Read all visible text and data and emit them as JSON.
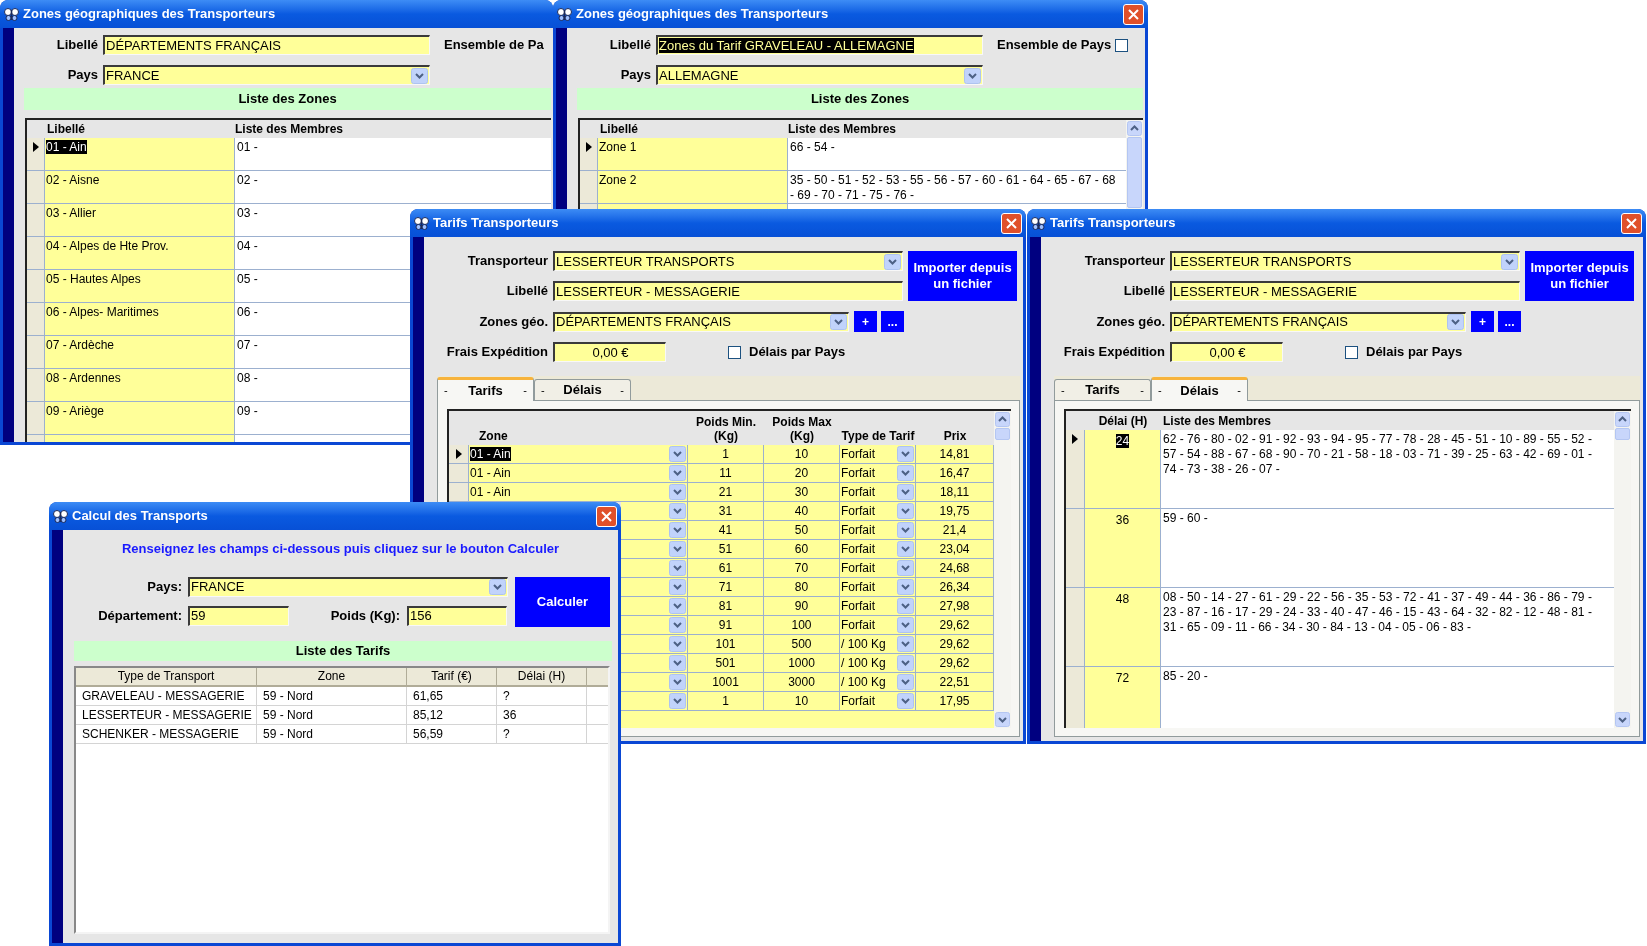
{
  "windows": [
    {
      "kind": "zones",
      "title": "Zones géographiques des Transporteurs",
      "libelle": {
        "label": "Libellé",
        "value": "DÉPARTEMENTS FRANÇAIS",
        "highlighted": false
      },
      "ensemble": {
        "label": "Ensemble de Pa"
      },
      "pays": {
        "label": "Pays",
        "value": "FRANCE"
      },
      "section": "Liste des Zones",
      "columns": [
        "Libellé",
        "Liste des Membres"
      ],
      "rows": [
        {
          "libelle": "01 - Ain",
          "membres": "01 -",
          "selected": true,
          "highlighted": true
        },
        {
          "libelle": "02 - Aisne",
          "membres": "02 -",
          "selected": false,
          "highlighted": false
        },
        {
          "libelle": "03 - Allier",
          "membres": "03 -",
          "selected": false,
          "highlighted": false
        },
        {
          "libelle": "04 - Alpes de Hte Prov.",
          "membres": "04 -",
          "selected": false,
          "highlighted": false
        },
        {
          "libelle": "05 - Hautes Alpes",
          "membres": "05 -",
          "selected": false,
          "highlighted": false
        },
        {
          "libelle": "06 - Alpes- Maritimes",
          "membres": "06 -",
          "selected": false,
          "highlighted": false
        },
        {
          "libelle": "07 - Ardèche",
          "membres": "07 -",
          "selected": false,
          "highlighted": false
        },
        {
          "libelle": "08 - Ardennes",
          "membres": "08 -",
          "selected": false,
          "highlighted": false
        },
        {
          "libelle": "09 - Ariège",
          "membres": "09 -",
          "selected": false,
          "highlighted": false
        }
      ]
    },
    {
      "kind": "zones",
      "title": "Zones géographiques des Transporteurs",
      "close_button": true,
      "scrollbar": true,
      "libelle": {
        "label": "Libellé",
        "value": "Zones du Tarif GRAVELEAU - ALLEMAGNE",
        "highlighted": true
      },
      "ensemble": {
        "label": "Ensemble de Pays",
        "checked": false
      },
      "pays": {
        "label": "Pays",
        "value": "ALLEMAGNE"
      },
      "section": "Liste des Zones",
      "columns": [
        "Libellé",
        "Liste des Membres"
      ],
      "rows": [
        {
          "libelle": "Zone 1",
          "membres": "66 - 54 -",
          "selected": true,
          "highlighted": false
        },
        {
          "libelle": "Zone 2",
          "membres": "35 - 50 - 51 - 52 - 53 - 55 - 56 - 57 - 60 - 61 - 64 - 65 - 67 - 68 - 69 - 70 - 71 - 75 - 76 -",
          "selected": false,
          "highlighted": false
        }
      ]
    },
    {
      "kind": "tarifs",
      "title": "Tarifs Transporteurs",
      "close_button": true,
      "transporteur": {
        "label": "Transporteur",
        "value": "LESSERTEUR TRANSPORTS"
      },
      "libelle": {
        "label": "Libellé",
        "value": "LESSERTEUR - MESSAGERIE"
      },
      "zones_geo": {
        "label": "Zones géo.",
        "value": "DÉPARTEMENTS FRANÇAIS",
        "add": "+",
        "browse": "..."
      },
      "import_button": "Importer depuis un fichier",
      "frais": {
        "label": "Frais Expédition",
        "value": "0,00 €"
      },
      "delais_par_pays": {
        "label": "Délais par Pays",
        "checked": false
      },
      "tabs": [
        {
          "left": "-",
          "label": "Tarifs",
          "right": "-",
          "selected": true
        },
        {
          "left": "-",
          "label": "Délais",
          "right": "-",
          "selected": false
        }
      ],
      "grid": {
        "kind": "tarifs",
        "columns": [
          "Zone",
          "Poids Min. (Kg)",
          "Poids Max (Kg)",
          "Type de Tarif",
          "Prix"
        ],
        "rows": [
          {
            "zone": "01 - Ain",
            "min": "1",
            "max": "10",
            "type": "Forfait",
            "prix": "14,81",
            "selected": true,
            "highlighted": true
          },
          {
            "zone": "01 - Ain",
            "min": "11",
            "max": "20",
            "type": "Forfait",
            "prix": "16,47",
            "selected": false,
            "highlighted": false
          },
          {
            "zone": "01 - Ain",
            "min": "21",
            "max": "30",
            "type": "Forfait",
            "prix": "18,11",
            "selected": false,
            "highlighted": false
          },
          {
            "min": "31",
            "max": "40",
            "type": "Forfait",
            "prix": "19,75"
          },
          {
            "min": "41",
            "max": "50",
            "type": "Forfait",
            "prix": "21,4"
          },
          {
            "min": "51",
            "max": "60",
            "type": "Forfait",
            "prix": "23,04"
          },
          {
            "min": "61",
            "max": "70",
            "type": "Forfait",
            "prix": "24,68"
          },
          {
            "min": "71",
            "max": "80",
            "type": "Forfait",
            "prix": "26,34"
          },
          {
            "min": "81",
            "max": "90",
            "type": "Forfait",
            "prix": "27,98"
          },
          {
            "min": "91",
            "max": "100",
            "type": "Forfait",
            "prix": "29,62"
          },
          {
            "min": "101",
            "max": "500",
            "type": "/ 100 Kg",
            "prix": "29,62"
          },
          {
            "min": "501",
            "max": "1000",
            "type": "/ 100 Kg",
            "prix": "29,62"
          },
          {
            "min": "1001",
            "max": "3000",
            "type": "/ 100 Kg",
            "prix": "22,51"
          },
          {
            "min": "1",
            "max": "10",
            "type": "Forfait",
            "prix": "17,95"
          }
        ]
      }
    },
    {
      "kind": "tarifs",
      "title": "Tarifs Transporteurs",
      "close_button": true,
      "transporteur": {
        "label": "Transporteur",
        "value": "LESSERTEUR TRANSPORTS"
      },
      "libelle": {
        "label": "Libellé",
        "value": "LESSERTEUR - MESSAGERIE"
      },
      "zones_geo": {
        "label": "Zones géo.",
        "value": "DÉPARTEMENTS FRANÇAIS",
        "add": "+",
        "browse": "..."
      },
      "import_button": "Importer depuis un fichier",
      "frais": {
        "label": "Frais Expédition",
        "value": "0,00 €"
      },
      "delais_par_pays": {
        "label": "Délais par Pays",
        "checked": false
      },
      "tabs": [
        {
          "left": "-",
          "label": "Tarifs",
          "right": "-",
          "selected": false
        },
        {
          "left": "-",
          "label": "Délais",
          "right": "-",
          "selected": true
        }
      ],
      "grid": {
        "kind": "delais",
        "columns": [
          "Délai (H)",
          "Liste des Membres"
        ],
        "rows": [
          {
            "delai": "24",
            "membres": "62 - 76 - 80 - 02 - 91 - 92 - 93 - 94 - 95 - 77 - 78 - 28 - 45 - 51 - 10 - 89 - 55 - 52 - 57 - 54 - 88 - 67 - 68 - 90 - 70 - 21 - 58 - 18 - 03 - 71 - 39 - 25 - 63 - 42 - 69 - 01 - 74 - 73 - 38 - 26 - 07 -",
            "selected": true,
            "highlighted": true
          },
          {
            "delai": "36",
            "membres": "59 - 60 -",
            "selected": false,
            "highlighted": false
          },
          {
            "delai": "48",
            "membres": "08 - 50 - 14 - 27 - 61 - 29 - 22 - 56 - 35 - 53 - 72 - 41 - 37 - 49 - 44 - 36 - 86 - 79 - 23 - 87 - 16 - 17 - 29 - 24 - 33 - 40 - 47 - 46 - 15 - 43 - 64 - 32 - 82 - 12 - 48 - 81 - 31 - 65 - 09 - 11 - 66 - 34 - 30 - 84 - 13 - 04 - 05 - 06 - 83 -",
            "selected": false,
            "highlighted": false
          },
          {
            "delai": "72",
            "membres": "85 - 20 -",
            "selected": false,
            "highlighted": false
          }
        ]
      }
    },
    {
      "kind": "calcul",
      "title": "Calcul des Transports",
      "close_button": true,
      "instruction": "Renseignez les champs ci-dessous puis cliquez sur le bouton Calculer",
      "pays": {
        "label": "Pays:",
        "value": "FRANCE"
      },
      "departement": {
        "label": "Département:",
        "value": "59"
      },
      "poids": {
        "label": "Poids (Kg):",
        "value": "156"
      },
      "calculer_button": "Calculer",
      "section": "Liste des Tarifs",
      "table": {
        "columns": [
          "Type de Transport",
          "Zone",
          "Tarif (€)",
          "Délai (H)"
        ],
        "rows": [
          [
            "GRAVELEAU - MESSAGERIE",
            "59 - Nord",
            "61,65",
            "?"
          ],
          [
            "LESSERTEUR - MESSAGERIE",
            "59 - Nord",
            "85,12",
            "36"
          ],
          [
            "SCHENKER - MESSAGERIE",
            "59 - Nord",
            "56,59",
            "?"
          ]
        ]
      }
    }
  ]
}
